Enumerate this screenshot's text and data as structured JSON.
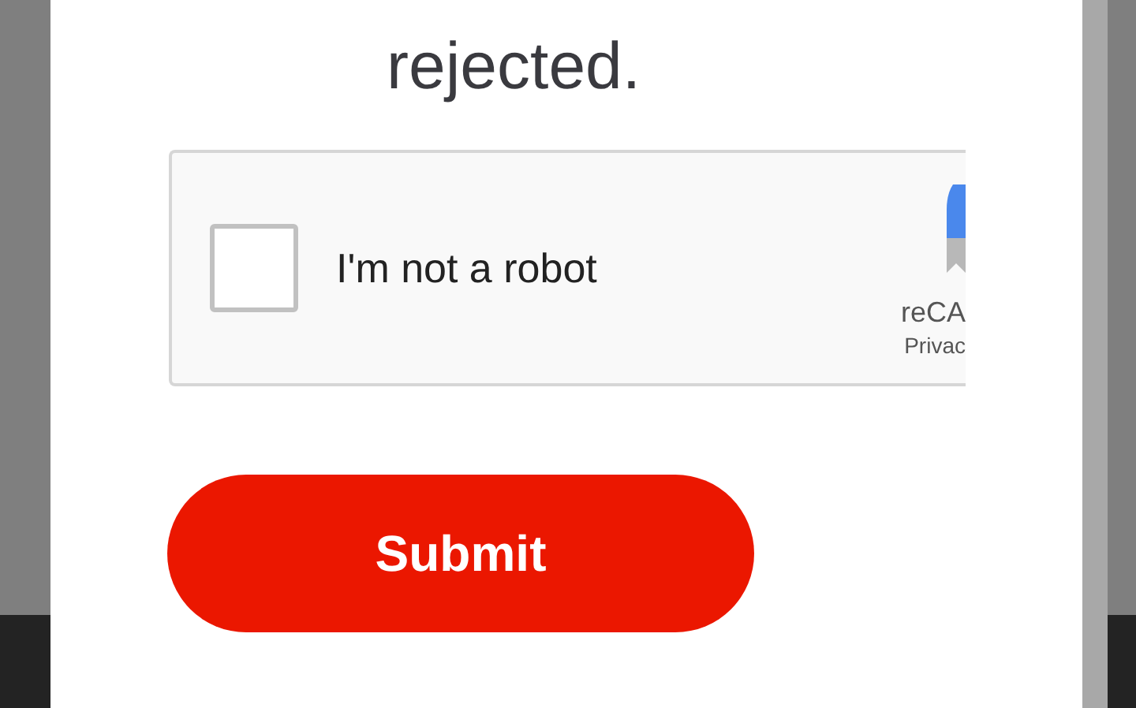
{
  "heading": "rejected.",
  "captcha": {
    "label": "I'm not a robot",
    "checked": false,
    "brand": "reCA",
    "privacy": "Privac"
  },
  "submit": {
    "label": "Submit"
  }
}
